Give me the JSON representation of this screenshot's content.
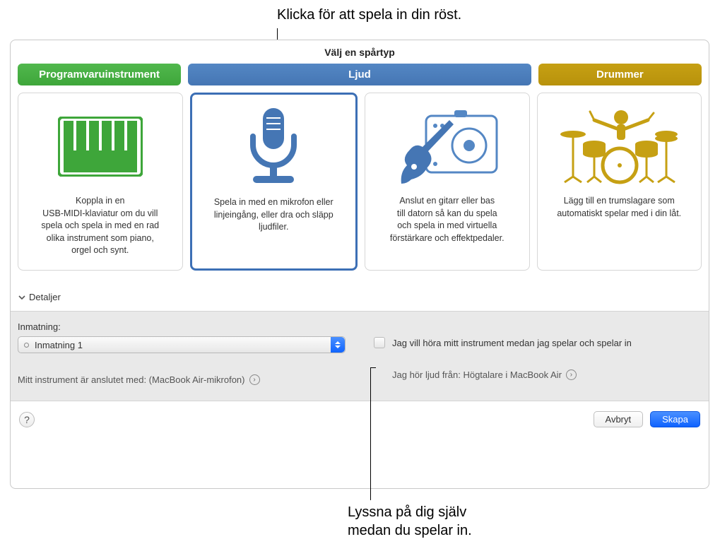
{
  "callouts": {
    "top": "Klicka för att spela in din röst.",
    "bottom": "Lyssna på dig själv\nmedan du spelar in."
  },
  "title": "Välj en spårtyp",
  "tabs": {
    "software": "Programvaruinstrument",
    "audio": "Ljud",
    "drummer": "Drummer"
  },
  "cards": {
    "keyboard": "Koppla in en\nUSB-MIDI-klaviatur om du vill\nspela och spela in med en rad\nolika instrument som piano,\norgel och synt.",
    "mic": "Spela in med en mikrofon eller\nlinjeingång, eller dra och släpp\nljudfiler.",
    "guitar": "Anslut en gitarr eller bas\ntill datorn så kan du spela\noch spela in med virtuella\nförstärkare och effektpedaler.",
    "drummer": "Lägg till en trumslagare som\nautomatiskt spelar med i din låt."
  },
  "details": {
    "label": "Detaljer",
    "input_label": "Inmatning:",
    "input_value": "Inmatning 1",
    "connected": "Mitt instrument är anslutet med: (MacBook Air-mikrofon)",
    "monitor_label": "Jag vill höra mitt instrument medan jag spelar och spelar in",
    "hear_from": "Jag hör ljud från: Högtalare i MacBook Air"
  },
  "footer": {
    "help": "?",
    "cancel": "Avbryt",
    "create": "Skapa"
  }
}
